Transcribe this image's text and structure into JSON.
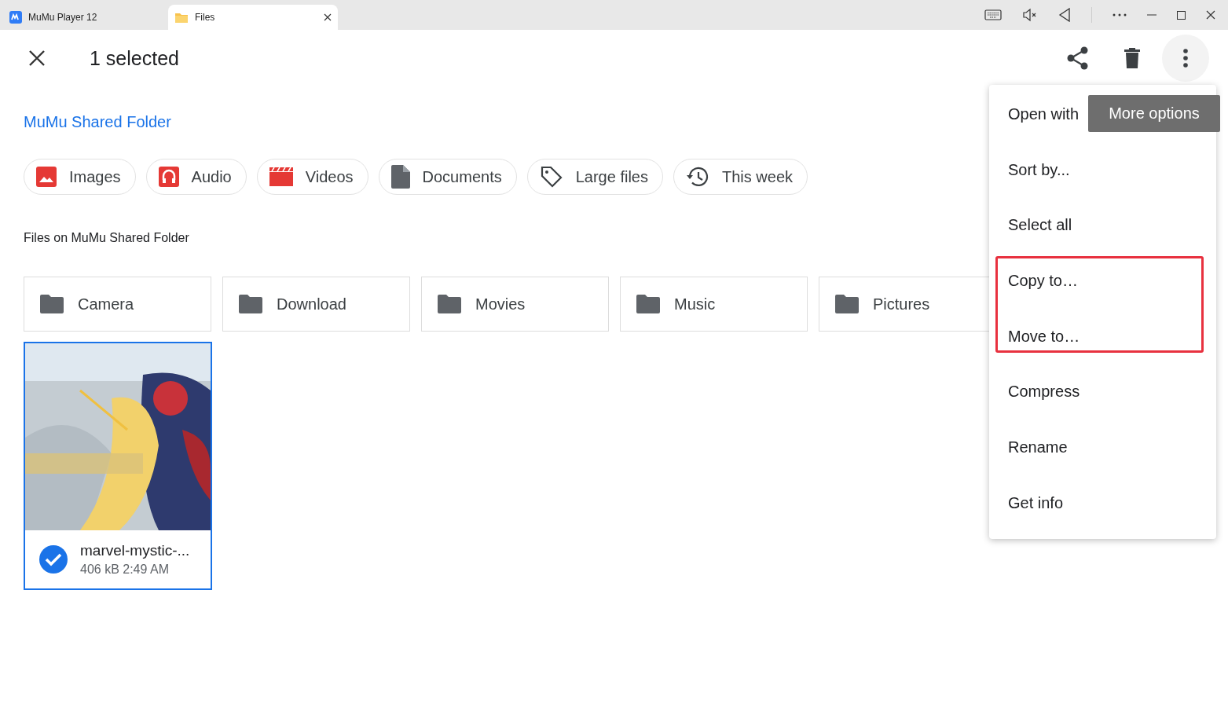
{
  "title_bar": {
    "tabs": [
      {
        "label": "MuMu Player 12",
        "kind": "app",
        "selected": false
      },
      {
        "label": "Files",
        "kind": "folder",
        "selected": true
      }
    ]
  },
  "toolbar": {
    "title": "1 selected"
  },
  "breadcrumb": "MuMu Shared Folder",
  "chips": [
    {
      "label": "Images",
      "kind": "images"
    },
    {
      "label": "Audio",
      "kind": "audio"
    },
    {
      "label": "Videos",
      "kind": "videos"
    },
    {
      "label": "Documents",
      "kind": "documents"
    },
    {
      "label": "Large files",
      "kind": "tag"
    },
    {
      "label": "This week",
      "kind": "history"
    }
  ],
  "section_title": "Files on MuMu Shared Folder",
  "folders": [
    "Camera",
    "Download",
    "Movies",
    "Music",
    "Pictures"
  ],
  "files": [
    {
      "kind": "picture",
      "name": "marvel-mystic-...",
      "meta": "406 kB 2:49 AM",
      "selected": true
    }
  ],
  "menu": [
    {
      "label": "Open with",
      "highlighted": false
    },
    {
      "label": "Sort by...",
      "highlighted": false
    },
    {
      "label": "Select all",
      "highlighted": false
    },
    {
      "label": "Copy to…",
      "highlighted": true
    },
    {
      "label": "Move to…",
      "highlighted": true
    },
    {
      "label": "Compress",
      "highlighted": false
    },
    {
      "label": "Rename",
      "highlighted": false
    },
    {
      "label": "Get info",
      "highlighted": false
    }
  ],
  "tooltip": "More options"
}
